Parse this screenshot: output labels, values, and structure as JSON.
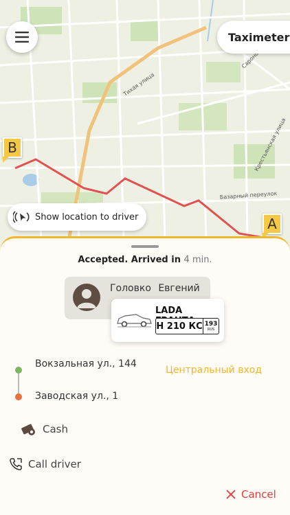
{
  "header": {
    "taximeter_label": "Taximeter"
  },
  "map": {
    "markers": {
      "start": "A",
      "end": "B"
    },
    "streets": [
      "Тихая улица",
      "Сарономинская улица",
      "Крестьянская улица",
      "Базарный переулок"
    ],
    "show_location_label": "Show location to driver",
    "route_color": "#e0514f"
  },
  "order": {
    "status_text": "Accepted. Arrived in",
    "eta": "4 min.",
    "driver": {
      "name": "Головко Евгений"
    },
    "car": {
      "model": "LADA ГРАНТА",
      "plate": "Н 210 КС",
      "region": "193",
      "country": "RUS"
    },
    "from_address": "Вокзальная ул., 144",
    "to_address": "Заводская ул., 1",
    "entrance_note": "Центральный вход",
    "payment_label": "Cash",
    "call_label": "Call driver",
    "cancel_label": "Cancel"
  },
  "colors": {
    "accent": "#f2b72d",
    "danger": "#e23b3b",
    "route_from": "#7bb661",
    "route_to": "#e8703c"
  },
  "icons": {
    "menu": "hamburger-icon",
    "location": "broadcast-location-icon",
    "avatar": "person-icon",
    "car": "car-icon",
    "cash": "cash-icon",
    "phone": "phone-icon",
    "close": "close-icon"
  }
}
